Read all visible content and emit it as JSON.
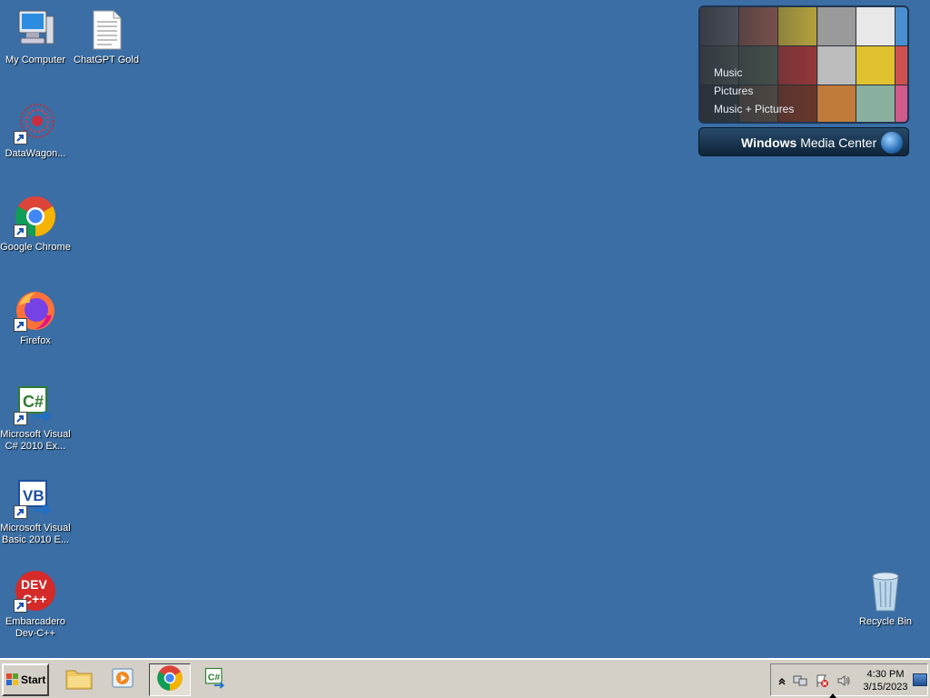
{
  "desktop": {
    "icons": [
      {
        "label": "My Computer",
        "icon": "computer-icon"
      },
      {
        "label": "ChatGPT Gold",
        "icon": "text-file-icon"
      },
      {
        "label": "DataWagon...",
        "icon": "datawagon-icon"
      },
      {
        "label": "Google Chrome",
        "icon": "chrome-icon"
      },
      {
        "label": "Firefox",
        "icon": "firefox-icon"
      },
      {
        "label": "Microsoft Visual C# 2010 Ex...",
        "icon": "visual-csharp-icon"
      },
      {
        "label": "Microsoft Visual Basic 2010 E...",
        "icon": "visual-basic-icon"
      },
      {
        "label": "Embarcadero Dev-C++",
        "icon": "dev-cpp-icon"
      },
      {
        "label": "Recycle Bin",
        "icon": "recycle-bin-icon"
      }
    ]
  },
  "media_center": {
    "menu": [
      "Music",
      "Pictures",
      "Music + Pictures"
    ],
    "title_bold": "Windows",
    "title_rest": " Media Center"
  },
  "taskbar": {
    "start_label": "Start",
    "pinned": [
      "file-explorer-icon",
      "media-player-icon",
      "chrome-icon",
      "visual-csharp-icon"
    ],
    "tray_icons": [
      "show-hidden-icons-icon",
      "network-icon",
      "action-center-icon",
      "volume-icon"
    ],
    "time": "4:30 PM",
    "date": "3/15/2023"
  },
  "colors": {
    "desktop_background": "#3a6ea5",
    "taskbar": "#d4d0c8"
  }
}
